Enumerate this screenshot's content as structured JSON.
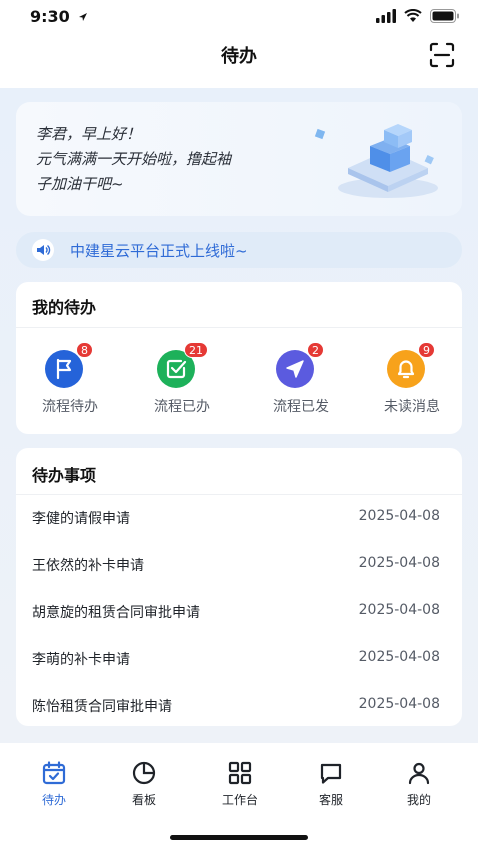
{
  "status_bar": {
    "time": "9:30"
  },
  "nav": {
    "title": "待办"
  },
  "welcome": {
    "line1": "李君，早上好！",
    "line2": "元气满满一天开始啦，撸起袖",
    "line3": "子加油干吧~"
  },
  "notice": {
    "text": "中建星云平台正式上线啦~"
  },
  "my_todo": {
    "title": "我的待办",
    "items": [
      {
        "label": "流程待办",
        "badge": "8",
        "icon": "flag-icon",
        "color": "#2563d9"
      },
      {
        "label": "流程已办",
        "badge": "21",
        "icon": "check-square-icon",
        "color": "#1db15a"
      },
      {
        "label": "流程已发",
        "badge": "2",
        "icon": "send-icon",
        "color": "#5b5bdf"
      },
      {
        "label": "未读消息",
        "badge": "9",
        "icon": "bell-icon",
        "color": "#f7a21b"
      }
    ]
  },
  "pending": {
    "title": "待办事项",
    "rows": [
      {
        "title": "李健的请假申请",
        "date": "2025-04-08"
      },
      {
        "title": "王依然的补卡申请",
        "date": "2025-04-08"
      },
      {
        "title": "胡意旋的租赁合同审批申请",
        "date": "2025-04-08"
      },
      {
        "title": "李萌的补卡申请",
        "date": "2025-04-08"
      },
      {
        "title": "陈怡租赁合同审批申请",
        "date": "2025-04-08"
      }
    ]
  },
  "tabs": [
    {
      "label": "待办",
      "icon": "calendar-icon"
    },
    {
      "label": "看板",
      "icon": "pie-chart-icon"
    },
    {
      "label": "工作台",
      "icon": "grid-icon"
    },
    {
      "label": "客服",
      "icon": "chat-icon"
    },
    {
      "label": "我的",
      "icon": "user-icon"
    }
  ],
  "colors": {
    "accent": "#2f6bd6",
    "badge": "#e53935"
  }
}
